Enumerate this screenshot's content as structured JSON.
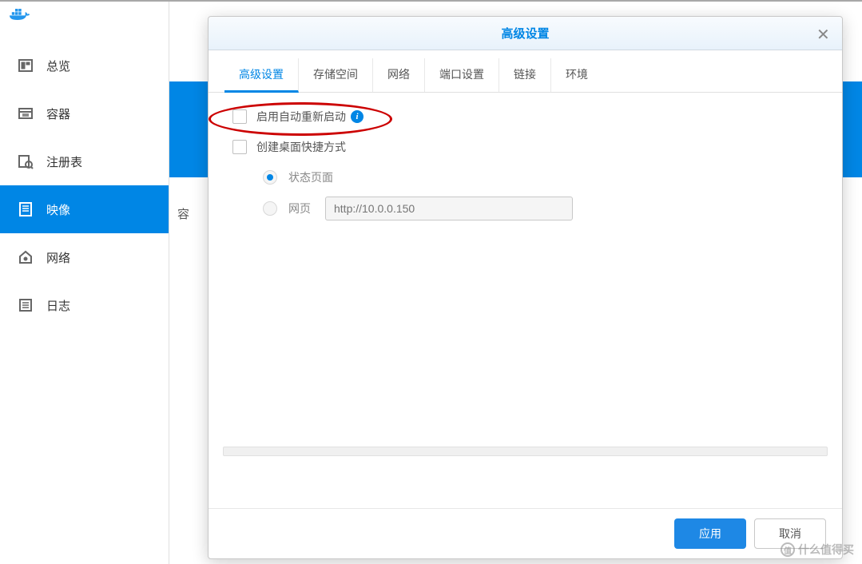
{
  "sidebar": {
    "items": [
      {
        "label": "总览"
      },
      {
        "label": "容器"
      },
      {
        "label": "注册表"
      },
      {
        "label": "映像"
      },
      {
        "label": "网络"
      },
      {
        "label": "日志"
      }
    ]
  },
  "main": {
    "partial_label": "容"
  },
  "modal": {
    "title": "高级设置",
    "tabs": [
      {
        "label": "高级设置"
      },
      {
        "label": "存储空间"
      },
      {
        "label": "网络"
      },
      {
        "label": "端口设置"
      },
      {
        "label": "链接"
      },
      {
        "label": "环境"
      }
    ],
    "form": {
      "auto_restart_label": "启用自动重新启动",
      "create_shortcut_label": "创建桌面快捷方式",
      "status_page_label": "状态页面",
      "webpage_label": "网页",
      "url_placeholder": "http://10.0.0.150"
    },
    "footer": {
      "apply_label": "应用",
      "cancel_label": "取消"
    }
  },
  "watermark": {
    "text": "什么值得买"
  }
}
